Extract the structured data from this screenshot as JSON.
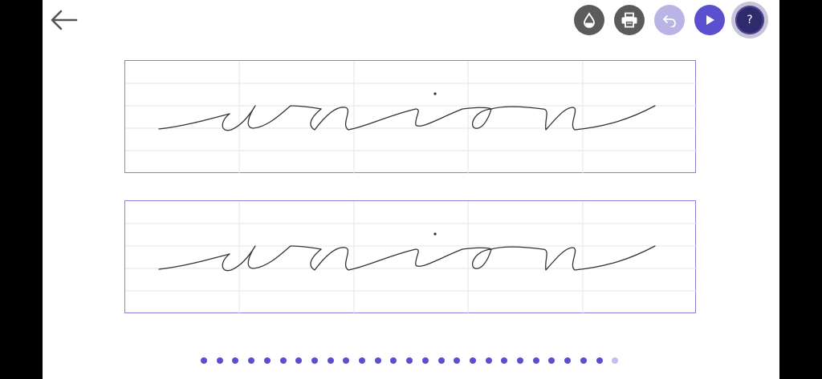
{
  "toolbar": {
    "icons": [
      "back-arrow-icon",
      "ink-drop-icon",
      "printer-icon",
      "undo-icon",
      "play-icon",
      "help-icon"
    ],
    "help_label": "?"
  },
  "worksheet": {
    "rows": [
      {
        "word": "union",
        "style": "cursive"
      },
      {
        "word": "union",
        "style": "cursive"
      }
    ]
  },
  "pagination": {
    "total": 27,
    "current": 27
  },
  "colors": {
    "accent": "#5a4fcf",
    "accent_light": "#b9b4e4",
    "toolbar_gray": "#5b5b5b",
    "panel_border": "#8a82d6",
    "guide_lines": "#e6e6ee",
    "ink": "#333333"
  }
}
